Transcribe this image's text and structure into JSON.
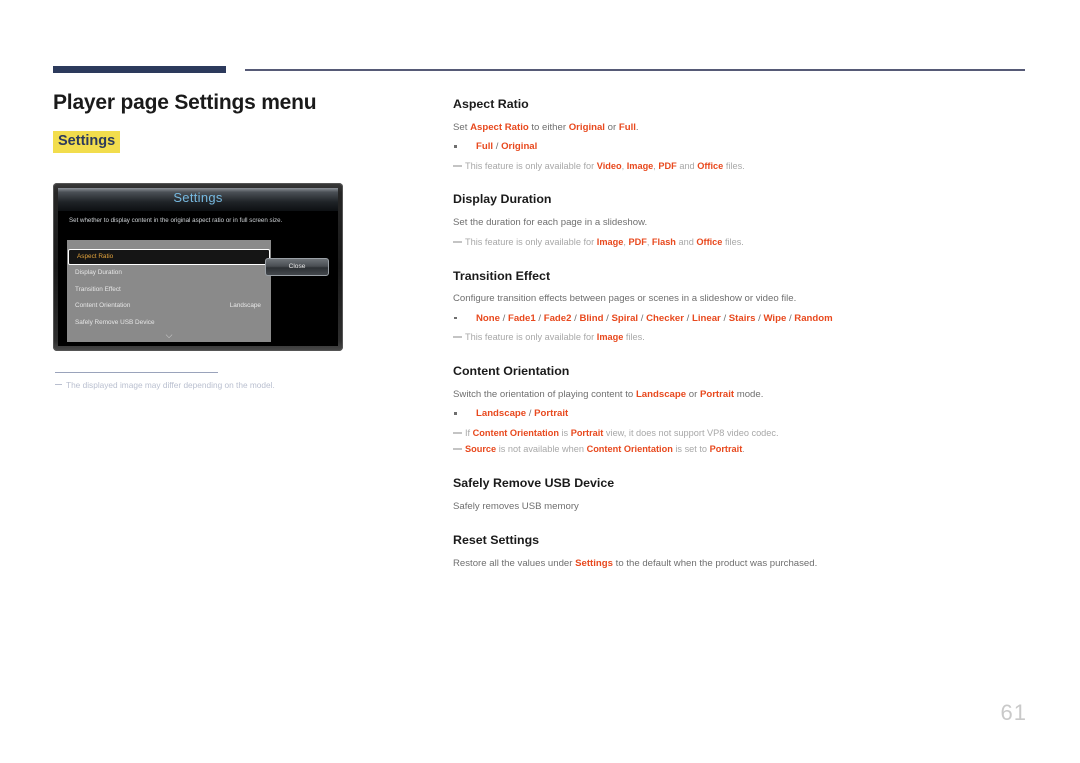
{
  "page": {
    "title": "Player page Settings menu",
    "tag": "Settings",
    "number": "61",
    "accent_color": "#e8491e",
    "rule_color": "#2c3a5c",
    "highlight_color": "#f2dd4d"
  },
  "figure": {
    "osd": {
      "title": "Settings",
      "description": "Set whether to display content in the original aspect ratio or in full screen size.",
      "rows": [
        {
          "label": "Aspect Ratio",
          "value": "",
          "selected": true
        },
        {
          "label": "Display Duration",
          "value": "",
          "selected": false
        },
        {
          "label": "Transition Effect",
          "value": "",
          "selected": false
        },
        {
          "label": "Content Orientation",
          "value": "Landscape",
          "selected": false
        },
        {
          "label": "Safely Remove USB Device",
          "value": "",
          "selected": false
        }
      ],
      "scroll_icon": "chevron-down-icon",
      "close_label": "Close"
    },
    "footnote": "The displayed image may differ depending on the model."
  },
  "sections": [
    {
      "title": "Aspect Ratio",
      "lines": [
        {
          "kind": "body",
          "parts": [
            {
              "t": "Set ",
              "s": "n"
            },
            {
              "t": "Aspect Ratio",
              "s": "o"
            },
            {
              "t": " to either ",
              "s": "n"
            },
            {
              "t": "Original",
              "s": "o"
            },
            {
              "t": " or ",
              "s": "n"
            },
            {
              "t": "Full",
              "s": "o"
            },
            {
              "t": ".",
              "s": "n"
            }
          ]
        },
        {
          "kind": "bullet",
          "parts": [
            {
              "t": "Full",
              "s": "o"
            },
            {
              "t": " / ",
              "s": "sep"
            },
            {
              "t": "Original",
              "s": "o"
            }
          ]
        },
        {
          "kind": "note",
          "parts": [
            {
              "t": "This feature is only available for ",
              "s": "n"
            },
            {
              "t": "Video",
              "s": "o"
            },
            {
              "t": ", ",
              "s": "n"
            },
            {
              "t": "Image",
              "s": "o"
            },
            {
              "t": ", ",
              "s": "n"
            },
            {
              "t": "PDF",
              "s": "o"
            },
            {
              "t": " and ",
              "s": "n"
            },
            {
              "t": "Office",
              "s": "o"
            },
            {
              "t": " files.",
              "s": "n"
            }
          ]
        }
      ]
    },
    {
      "title": "Display Duration",
      "lines": [
        {
          "kind": "body",
          "parts": [
            {
              "t": "Set the duration for each page in a slideshow.",
              "s": "n"
            }
          ]
        },
        {
          "kind": "note",
          "parts": [
            {
              "t": "This feature is only available for ",
              "s": "n"
            },
            {
              "t": "Image",
              "s": "o"
            },
            {
              "t": ", ",
              "s": "n"
            },
            {
              "t": "PDF",
              "s": "o"
            },
            {
              "t": ", ",
              "s": "n"
            },
            {
              "t": "Flash",
              "s": "o"
            },
            {
              "t": " and ",
              "s": "n"
            },
            {
              "t": "Office",
              "s": "o"
            },
            {
              "t": " files.",
              "s": "n"
            }
          ]
        }
      ]
    },
    {
      "title": "Transition Effect",
      "lines": [
        {
          "kind": "body",
          "parts": [
            {
              "t": "Configure transition effects between pages or scenes in a slideshow or video file.",
              "s": "n"
            }
          ]
        },
        {
          "kind": "bullet",
          "parts": [
            {
              "t": "None",
              "s": "o"
            },
            {
              "t": " / ",
              "s": "sep"
            },
            {
              "t": "Fade1",
              "s": "o"
            },
            {
              "t": " / ",
              "s": "sep"
            },
            {
              "t": "Fade2",
              "s": "o"
            },
            {
              "t": " / ",
              "s": "sep"
            },
            {
              "t": "Blind",
              "s": "o"
            },
            {
              "t": " / ",
              "s": "sep"
            },
            {
              "t": "Spiral",
              "s": "o"
            },
            {
              "t": " / ",
              "s": "sep"
            },
            {
              "t": "Checker",
              "s": "o"
            },
            {
              "t": " / ",
              "s": "sep"
            },
            {
              "t": "Linear",
              "s": "o"
            },
            {
              "t": " / ",
              "s": "sep"
            },
            {
              "t": "Stairs",
              "s": "o"
            },
            {
              "t": " / ",
              "s": "sep"
            },
            {
              "t": "Wipe",
              "s": "o"
            },
            {
              "t": " / ",
              "s": "sep"
            },
            {
              "t": "Random",
              "s": "o"
            }
          ]
        },
        {
          "kind": "note",
          "parts": [
            {
              "t": "This feature is only available for ",
              "s": "n"
            },
            {
              "t": "Image",
              "s": "o"
            },
            {
              "t": " files.",
              "s": "n"
            }
          ]
        }
      ]
    },
    {
      "title": "Content Orientation",
      "lines": [
        {
          "kind": "body",
          "parts": [
            {
              "t": "Switch the orientation of playing content to ",
              "s": "n"
            },
            {
              "t": "Landscape",
              "s": "o"
            },
            {
              "t": " or ",
              "s": "n"
            },
            {
              "t": "Portrait",
              "s": "o"
            },
            {
              "t": " mode.",
              "s": "n"
            }
          ]
        },
        {
          "kind": "bullet",
          "parts": [
            {
              "t": "Landscape",
              "s": "o"
            },
            {
              "t": " / ",
              "s": "sep"
            },
            {
              "t": "Portrait",
              "s": "o"
            }
          ]
        },
        {
          "kind": "note",
          "parts": [
            {
              "t": "If ",
              "s": "n"
            },
            {
              "t": "Content Orientation",
              "s": "o"
            },
            {
              "t": " is ",
              "s": "n"
            },
            {
              "t": "Portrait",
              "s": "o"
            },
            {
              "t": " view, it does not support VP8 video codec.",
              "s": "n"
            }
          ]
        },
        {
          "kind": "note",
          "parts": [
            {
              "t": "Source",
              "s": "o"
            },
            {
              "t": " is not available when ",
              "s": "n"
            },
            {
              "t": "Content Orientation",
              "s": "o"
            },
            {
              "t": " is set to ",
              "s": "n"
            },
            {
              "t": "Portrait",
              "s": "o"
            },
            {
              "t": ".",
              "s": "n"
            }
          ]
        }
      ]
    },
    {
      "title": "Safely Remove USB Device",
      "lines": [
        {
          "kind": "body",
          "parts": [
            {
              "t": "Safely removes USB memory",
              "s": "n"
            }
          ]
        }
      ]
    },
    {
      "title": "Reset Settings",
      "lines": [
        {
          "kind": "body",
          "parts": [
            {
              "t": "Restore all the values under ",
              "s": "n"
            },
            {
              "t": "Settings",
              "s": "o"
            },
            {
              "t": " to the default when the product was purchased.",
              "s": "n"
            }
          ]
        }
      ]
    }
  ]
}
